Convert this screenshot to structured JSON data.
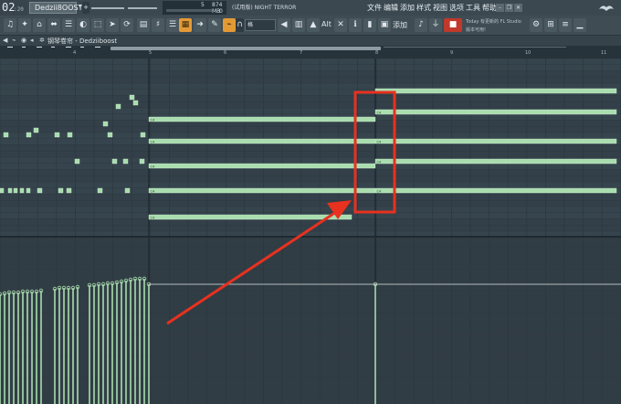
{
  "header": {
    "time_big": "02",
    "time_small": ":20",
    "pattern_name": "Dedzii8OOST",
    "cpu_value": "5",
    "memory": "874 MB",
    "cpu_value_2": "0",
    "song_title": "(试用版) NIGHT TERROR",
    "menu": [
      "文件",
      "编辑",
      "添加",
      "样式",
      "视图",
      "选项",
      "工具",
      "帮助"
    ],
    "window_controls": [
      "–",
      "❐",
      "✕"
    ]
  },
  "toolbar": {
    "buttons": [
      "♫",
      "✦",
      "⌂",
      "⬌",
      "☰",
      "◐",
      "⬚",
      "➤",
      "⟳"
    ],
    "snap_value": "格",
    "label_alt": "Alt",
    "label_add": "添加",
    "news_line1": "Today  有更新的 FL Studio",
    "news_line2": "版本可用!"
  },
  "toolrow": {
    "breadcrumb": "钢琴卷帘 - Dedziiboost"
  },
  "ruler": {
    "bar_numbers": [
      "4",
      "5",
      "6",
      "7",
      "8",
      "9",
      "10",
      "11"
    ]
  },
  "piano_roll": {
    "note_label": "C4",
    "note_color": "#a9dcae",
    "note_edge_color": "#cfeed2",
    "background_color": "#334049"
  },
  "annotation": {
    "color": "#e8311f"
  }
}
